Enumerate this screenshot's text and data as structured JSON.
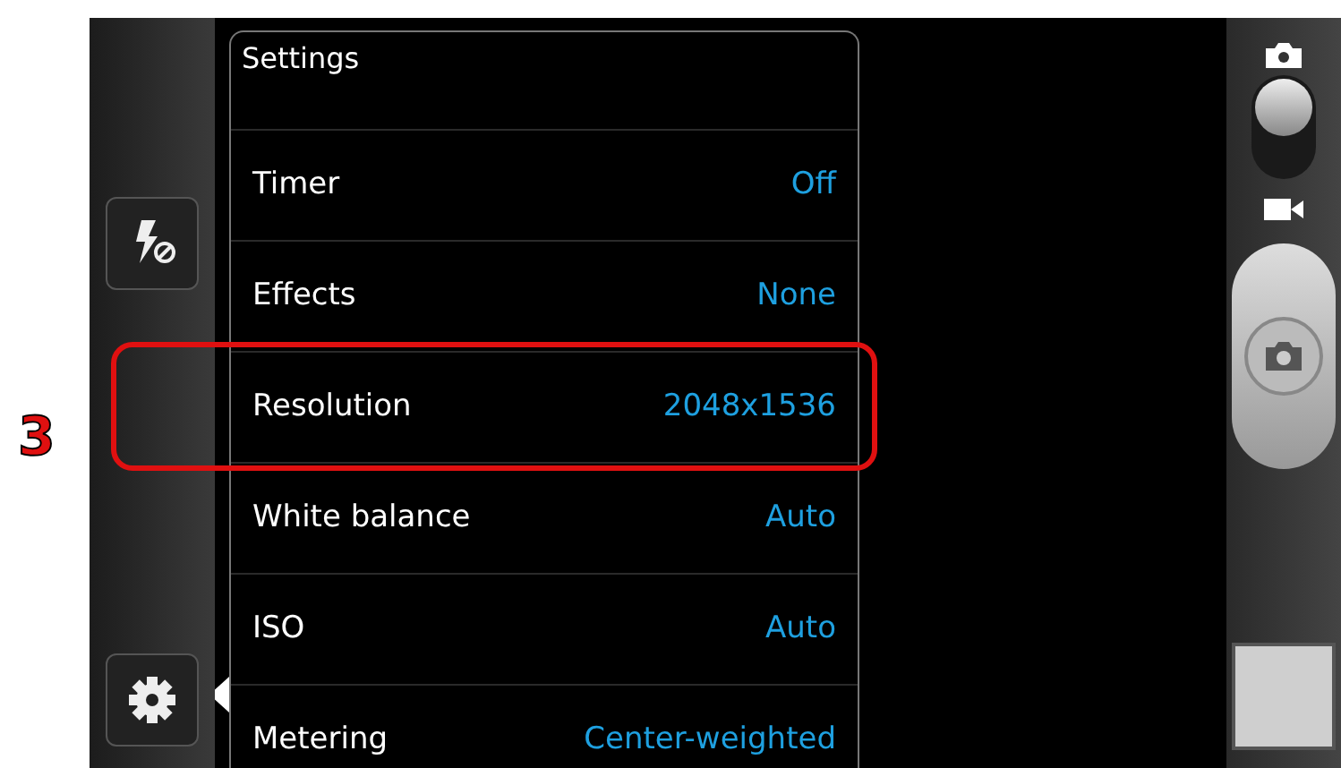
{
  "panel": {
    "title": "Settings"
  },
  "settings": [
    {
      "label": "Timer",
      "value": "Off",
      "highlighted": false
    },
    {
      "label": "Effects",
      "value": "None",
      "highlighted": false
    },
    {
      "label": "Resolution",
      "value": "2048x1536",
      "highlighted": true
    },
    {
      "label": "White balance",
      "value": "Auto",
      "highlighted": false
    },
    {
      "label": "ISO",
      "value": "Auto",
      "highlighted": false
    },
    {
      "label": "Metering",
      "value": "Center-weighted",
      "highlighted": false
    }
  ],
  "annotation": {
    "label": "3"
  },
  "mode_switch": {
    "photo_selected": true
  }
}
